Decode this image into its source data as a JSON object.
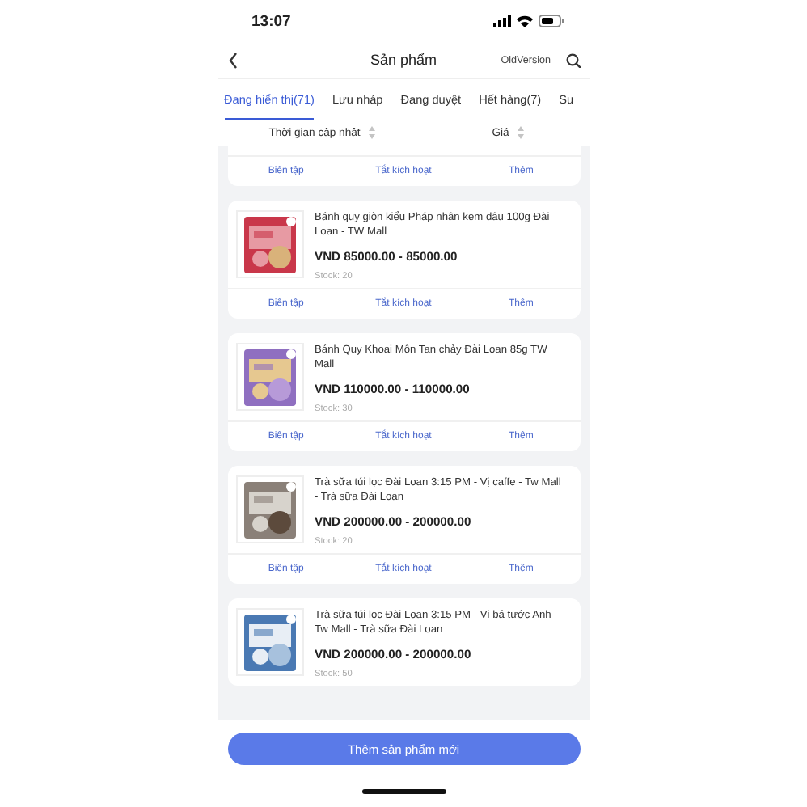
{
  "status_bar": {
    "time": "13:07"
  },
  "header": {
    "title": "Sản phẩm",
    "version_link": "OldVersion"
  },
  "tabs": [
    {
      "label": "Đang hiển thị(71)",
      "selected": true
    },
    {
      "label": "Lưu nháp",
      "selected": false
    },
    {
      "label": "Đang duyệt",
      "selected": false
    },
    {
      "label": "Hết hàng(7)",
      "selected": false
    },
    {
      "label": "Su",
      "selected": false
    }
  ],
  "sort_options": [
    {
      "label": "Thời gian cập nhật"
    },
    {
      "label": "Giá"
    }
  ],
  "products": [
    {
      "kind": "partial",
      "actions": [
        "Biên tập",
        "Tắt kích hoạt",
        "Thêm"
      ]
    },
    {
      "kind": "full",
      "title": "Bánh quy giòn kiểu Pháp nhân kem dâu 100g Đài Loan - TW Mall",
      "price": "VND 85000.00 - 85000.00",
      "stock": "Stock: 20",
      "actions": [
        "Biên tập",
        "Tắt kích hoạt",
        "Thêm"
      ]
    },
    {
      "kind": "full",
      "title": "Bánh Quy Khoai Môn Tan chảy Đài Loan 85g TW Mall",
      "price": "VND 110000.00 - 110000.00",
      "stock": "Stock: 30",
      "actions": [
        "Biên tập",
        "Tắt kích hoạt",
        "Thêm"
      ]
    },
    {
      "kind": "full",
      "title": "Trà sữa túi lọc Đài Loan 3:15 PM - Vị caffe - Tw Mall - Trà sữa Đài Loan",
      "price": "VND 200000.00 - 200000.00",
      "stock": "Stock: 20",
      "actions": [
        "Biên tập",
        "Tắt kích hoạt",
        "Thêm"
      ]
    },
    {
      "kind": "full",
      "title": "Trà sữa túi lọc Đài Loan 3:15 PM - Vị bá tước Anh - Tw Mall - Trà sữa Đài Loan",
      "price": "VND 200000.00 - 200000.00",
      "stock": "Stock: 50"
    }
  ],
  "add_button": {
    "label": "Thêm sản phẩm mới"
  }
}
